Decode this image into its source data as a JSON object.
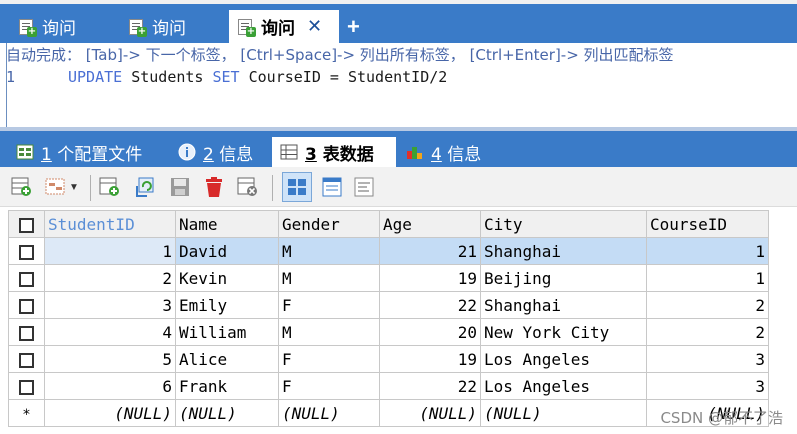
{
  "query_tabs": [
    {
      "label": "询问"
    },
    {
      "label": "询问"
    },
    {
      "label": "询问",
      "active": true
    }
  ],
  "editor": {
    "autocomplete_hint": "自动完成： [Tab]-> 下一个标签， [Ctrl+Space]-> 列出所有标签， [Ctrl+Enter]-> 列出匹配标签",
    "line_number": "1",
    "sql": {
      "kw_update": "UPDATE",
      "table": " Students ",
      "kw_set": "SET",
      "assignment": " CourseID = StudentID/2"
    }
  },
  "result_tabs": [
    {
      "num": "1",
      "label": " 个配置文件"
    },
    {
      "num": "2",
      "label": " 信息"
    },
    {
      "num": "3",
      "label": " 表数据",
      "active": true
    },
    {
      "num": "4",
      "label": " 信息"
    }
  ],
  "grid": {
    "columns": [
      "StudentID",
      "Name",
      "Gender",
      "Age",
      "City",
      "CourseID"
    ],
    "rows": [
      [
        "1",
        "David",
        "M",
        "21",
        "Shanghai",
        "1"
      ],
      [
        "2",
        "Kevin",
        "M",
        "19",
        "Beijing",
        "1"
      ],
      [
        "3",
        "Emily",
        "F",
        "22",
        "Shanghai",
        "2"
      ],
      [
        "4",
        "William",
        "M",
        "20",
        "New York City",
        "2"
      ],
      [
        "5",
        "Alice",
        "F",
        "19",
        "Los Angeles",
        "3"
      ],
      [
        "6",
        "Frank",
        "F",
        "22",
        "Los Angeles",
        "3"
      ]
    ],
    "new_row_marker": "*",
    "null_text": "(NULL)"
  },
  "watermark": "CSDN @郁不了浩",
  "colors": {
    "tab_bar": "#3a7bc8",
    "selected_row": "#c4dcf5",
    "keyword": "#4a6fd4"
  }
}
